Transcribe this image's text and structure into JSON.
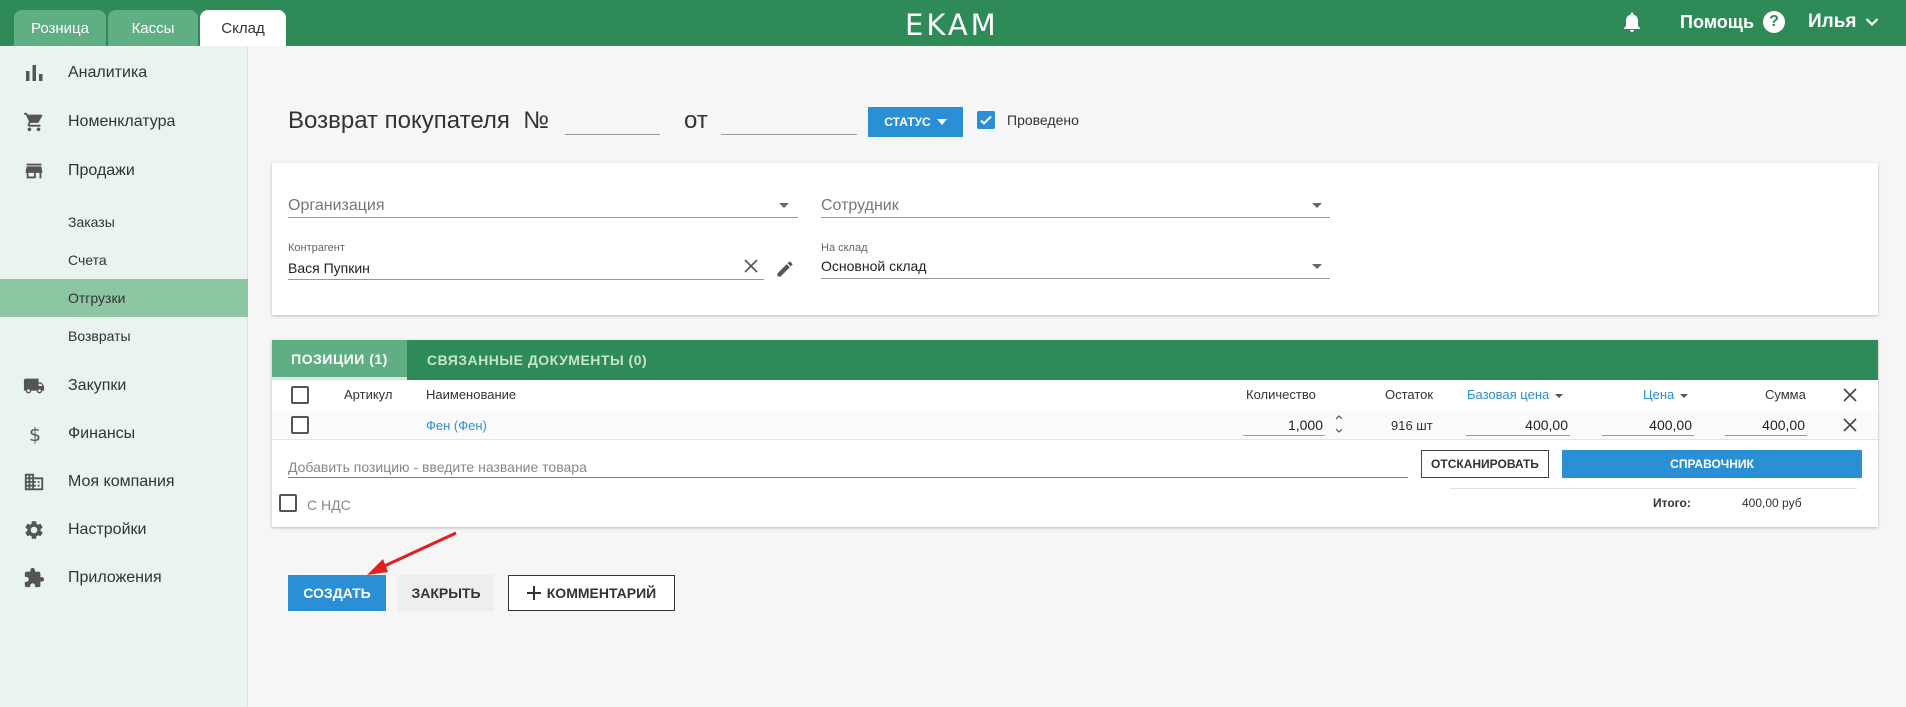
{
  "colors": {
    "brand_green": "#2e8b57",
    "tab_green": "#5fae84",
    "sidebar_active": "#8cc6a3",
    "accent_blue": "#2a8fd4",
    "arrow_red": "#e02020"
  },
  "top_tabs": [
    {
      "label": "Розница",
      "active": false
    },
    {
      "label": "Кассы",
      "active": false
    },
    {
      "label": "Склад",
      "active": true
    }
  ],
  "logo": "EKAM",
  "header": {
    "help_label": "Помощь",
    "help_icon": "?",
    "user_name": "Илья"
  },
  "sidebar": {
    "items": [
      {
        "label": "Аналитика",
        "icon": "bar-chart-icon"
      },
      {
        "label": "Номенклатура",
        "icon": "cart-icon"
      },
      {
        "label": "Продажи",
        "icon": "store-icon"
      },
      {
        "label": "Закупки",
        "icon": "truck-icon"
      },
      {
        "label": "Финансы",
        "icon": "dollar-icon"
      },
      {
        "label": "Моя компания",
        "icon": "building-icon"
      },
      {
        "label": "Настройки",
        "icon": "gear-icon"
      },
      {
        "label": "Приложения",
        "icon": "puzzle-icon"
      }
    ],
    "sales_subitems": [
      {
        "label": "Заказы",
        "active": false
      },
      {
        "label": "Счета",
        "active": false
      },
      {
        "label": "Отгрузки",
        "active": true
      },
      {
        "label": "Возвраты",
        "active": false
      }
    ]
  },
  "doc": {
    "title": "Возврат покупателя  №",
    "date_prefix": "от",
    "status_label": "СТАТУС",
    "posted_label": "Проведено",
    "posted_checked": true
  },
  "form": {
    "organization_placeholder": "Организация",
    "employee_placeholder": "Сотрудник",
    "counterparty_label": "Контрагент",
    "counterparty_value": "Вася Пупкин",
    "warehouse_label": "На склад",
    "warehouse_value": "Основной склад"
  },
  "positions_tabs": [
    {
      "label": "ПОЗИЦИИ (1)",
      "active": true
    },
    {
      "label": "СВЯЗАННЫЕ ДОКУМЕНТЫ (0)",
      "active": false
    }
  ],
  "table": {
    "headers": {
      "article": "Артикул",
      "name": "Наименование",
      "quantity": "Количество",
      "stock": "Остаток",
      "base_price": "Базовая цена",
      "price": "Цена",
      "sum": "Сумма"
    },
    "rows": [
      {
        "article": "",
        "name": "Фен (Фен)",
        "quantity": "1,000",
        "stock": "916 шт",
        "base_price": "400,00",
        "price": "400,00",
        "sum": "400,00"
      }
    ]
  },
  "add_position_placeholder": "Добавить позицию - введите название товара",
  "scan_label": "ОТСКАНИРОВАТЬ",
  "catalog_label": "СПРАВОЧНИК",
  "vat_label": "С НДС",
  "total_label": "Итого:",
  "total_value": "400,00 руб",
  "actions": {
    "create_label": "СОЗДАТЬ",
    "close_label": "ЗАКРЫТЬ",
    "comment_label": "КОММЕНТАРИЙ"
  }
}
